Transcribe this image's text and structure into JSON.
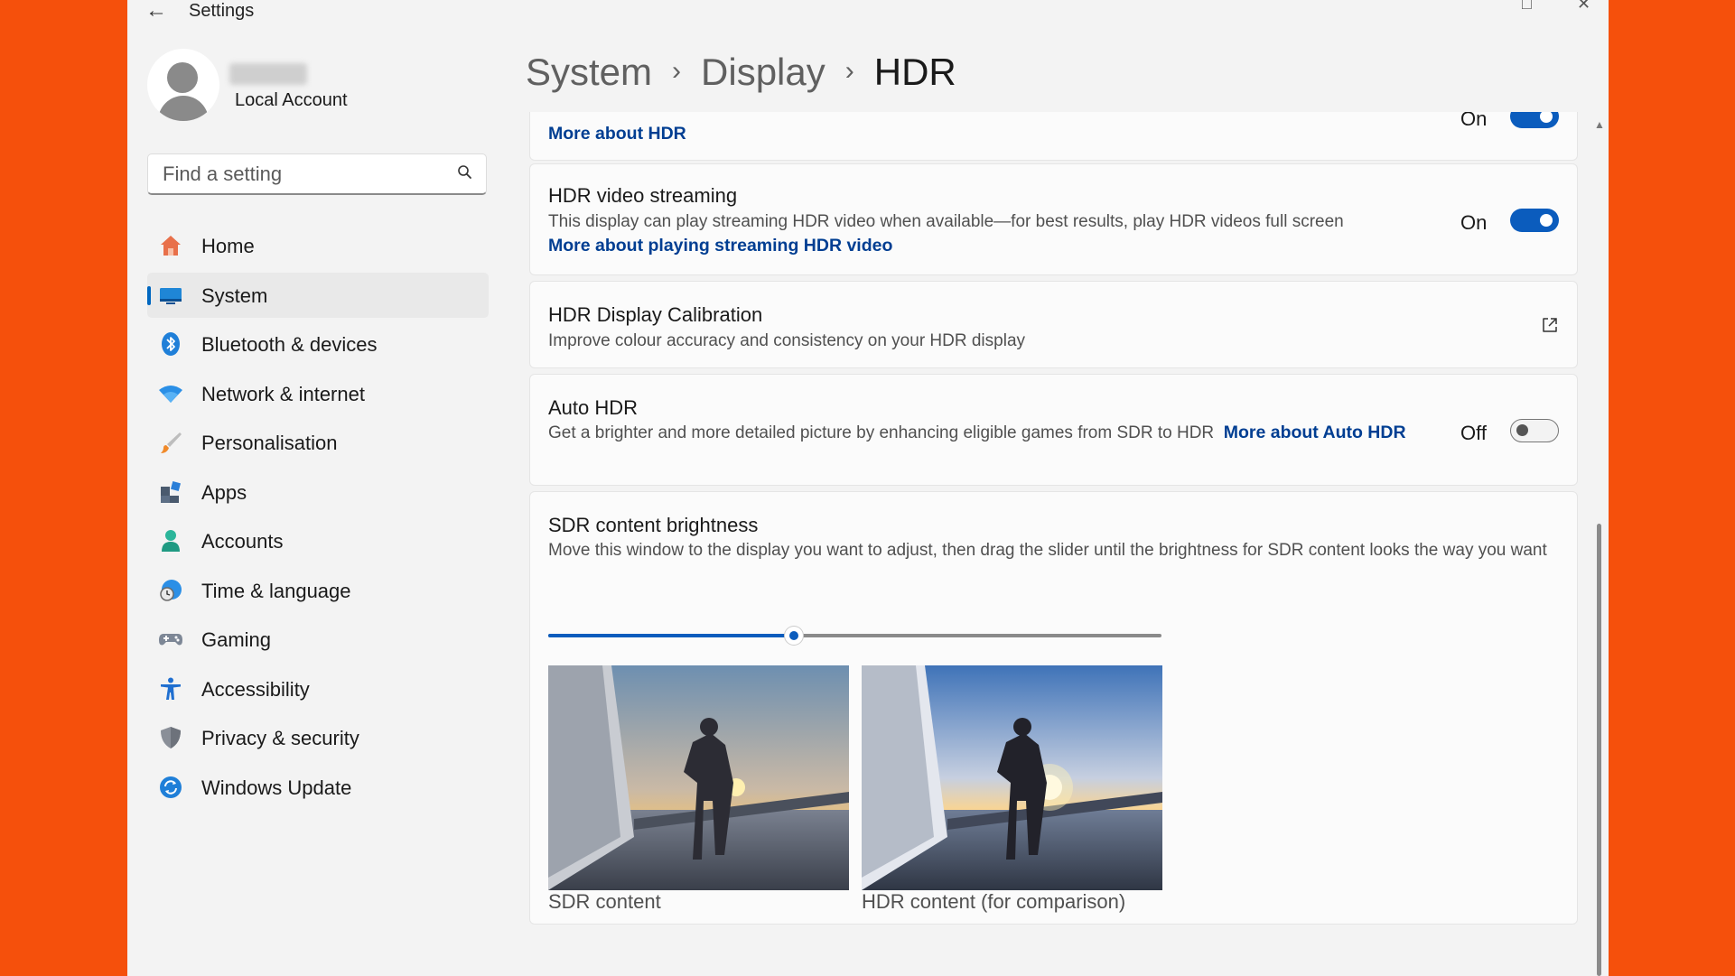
{
  "window": {
    "title": "Settings"
  },
  "profile": {
    "name": "",
    "account_type": "Local Account"
  },
  "search": {
    "placeholder": "Find a setting"
  },
  "nav": {
    "items": [
      {
        "label": "Home",
        "icon": "home-icon"
      },
      {
        "label": "System",
        "icon": "system-icon",
        "selected": true
      },
      {
        "label": "Bluetooth & devices",
        "icon": "bluetooth-icon"
      },
      {
        "label": "Network & internet",
        "icon": "wifi-icon"
      },
      {
        "label": "Personalisation",
        "icon": "brush-icon"
      },
      {
        "label": "Apps",
        "icon": "apps-icon"
      },
      {
        "label": "Accounts",
        "icon": "person-icon"
      },
      {
        "label": "Time & language",
        "icon": "clock-globe-icon"
      },
      {
        "label": "Gaming",
        "icon": "gamepad-icon"
      },
      {
        "label": "Accessibility",
        "icon": "accessibility-icon"
      },
      {
        "label": "Privacy & security",
        "icon": "shield-icon"
      },
      {
        "label": "Windows Update",
        "icon": "update-icon"
      }
    ]
  },
  "breadcrumb": {
    "level1": "System",
    "level2": "Display",
    "current": "HDR"
  },
  "cards": {
    "use_hdr": {
      "link": "More about HDR",
      "toggle_label": "On",
      "toggle_on": true
    },
    "video_streaming": {
      "title": "HDR video streaming",
      "description": "This display can play streaming HDR video when available—for best results, play HDR videos full screen",
      "link": "More about playing streaming HDR video",
      "toggle_label": "On",
      "toggle_on": true
    },
    "calibration": {
      "title": "HDR Display Calibration",
      "description": "Improve colour accuracy and consistency on your HDR display",
      "icon": "external-link-icon"
    },
    "auto_hdr": {
      "title": "Auto HDR",
      "description": "Get a brighter and more detailed picture by enhancing eligible games from SDR to HDR",
      "link": "More about Auto HDR",
      "toggle_label": "Off",
      "toggle_on": false
    },
    "sdr_brightness": {
      "title": "SDR content brightness",
      "description": "Move this window to the display you want to adjust, then drag the slider until the brightness for SDR content looks the way you want",
      "slider_value": 0.4,
      "sdr_caption": "SDR content",
      "hdr_caption": "HDR content (for comparison)"
    }
  },
  "colors": {
    "accent": "#0b5cbd",
    "link": "#003e92",
    "background": "#f5500c"
  }
}
